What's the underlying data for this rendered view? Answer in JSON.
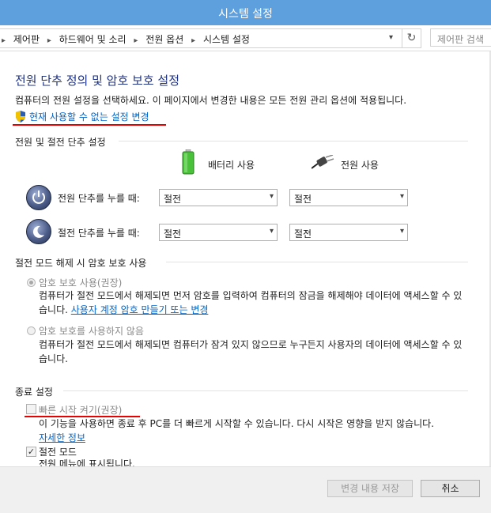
{
  "window": {
    "title": "시스템 설정"
  },
  "address": {
    "crumbs": [
      "제어판",
      "하드웨어 및 소리",
      "전원 옵션",
      "시스템 설정"
    ],
    "search_placeholder": "제어판 검색"
  },
  "page": {
    "heading": "전원 단추 정의 및 암호 보호 설정",
    "description": "컴퓨터의 전원 설정을 선택하세요. 이 페이지에서 변경한 내용은 모든 전원 관리 옵션에 적용됩니다.",
    "change_link": "현재 사용할 수 없는 설정 변경"
  },
  "power_buttons": {
    "section_title": "전원 및 절전 단추 설정",
    "col_battery": "배터리 사용",
    "col_plugged": "전원 사용",
    "rows": [
      {
        "label": "전원 단추를 누를 때:",
        "battery": "절전",
        "plugged": "절전"
      },
      {
        "label": "절전 단추를 누를 때:",
        "battery": "절전",
        "plugged": "절전"
      }
    ]
  },
  "password": {
    "section_title": "절전 모드 해제 시 암호 보호 사용",
    "opt1_label": "암호 보호 사용(권장)",
    "opt1_text": "컴퓨터가 절전 모드에서 해제되면 먼저 암호를 입력하여 컴퓨터의 잠금을 해제해야 데이터에 액세스할 수 있습니다.",
    "opt1_link": "사용자 계정 암호 만들기 또는 변경",
    "opt2_label": "암호 보호를 사용하지 않음",
    "opt2_text": "컴퓨터가 절전 모드에서 해제되면 컴퓨터가 잠겨 있지 않으므로 누구든지 사용자의 데이터에 액세스할 수 있습니다."
  },
  "shutdown": {
    "section_title": "종료 설정",
    "fast_startup_label": "빠른 시작 켜기(권장)",
    "fast_startup_text": "이 기능을 사용하면 종료 후 PC를 더 빠르게 시작할 수 있습니다. 다시 시작은 영향을 받지 않습니다.",
    "fast_startup_link": "자세한 정보",
    "sleep_label": "절전 모드",
    "sleep_text": "전원 메뉴에 표시됩니다."
  },
  "footer": {
    "save_label": "변경 내용 저장",
    "cancel_label": "취소"
  },
  "colors": {
    "titlebar": "#5e9fde",
    "heading": "#1e3287",
    "link": "#0066cc",
    "highlight": "#e60000"
  }
}
